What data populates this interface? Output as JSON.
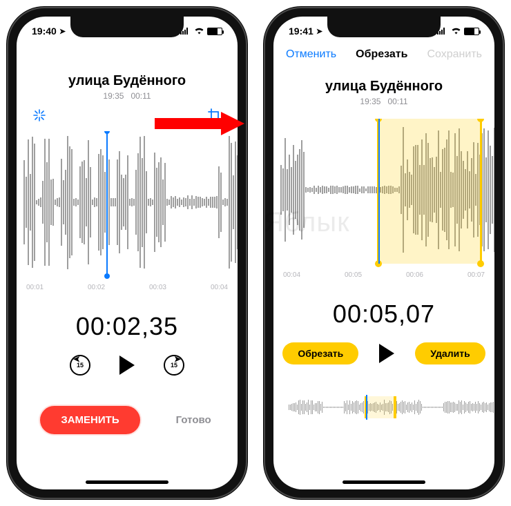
{
  "watermark": "Яблык",
  "phone1": {
    "status": {
      "time": "19:40"
    },
    "title": "улица Будённого",
    "meta_time": "19:35",
    "meta_dur": "00:11",
    "ticks": [
      "00:01",
      "00:02",
      "00:03",
      "00:04"
    ],
    "big_time": "00:02,35",
    "skip_amount": "15",
    "replace_label": "ЗАМЕНИТЬ",
    "done_label": "Готово"
  },
  "phone2": {
    "status": {
      "time": "19:41"
    },
    "nav_cancel": "Отменить",
    "nav_title": "Обрезать",
    "nav_save": "Сохранить",
    "title": "улица Будённого",
    "meta_time": "19:35",
    "meta_dur": "00:11",
    "ticks": [
      "00:04",
      "00:05",
      "00:06",
      "00:07"
    ],
    "big_time": "00:05,07",
    "trim_label": "Обрезать",
    "delete_label": "Удалить"
  }
}
